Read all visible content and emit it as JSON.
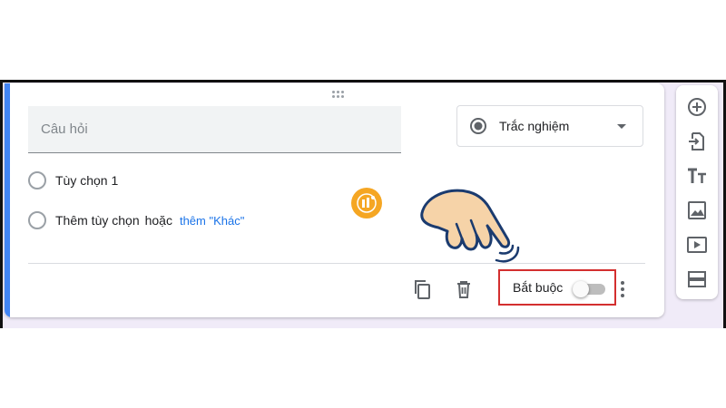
{
  "question": {
    "placeholder": "Câu hỏi"
  },
  "question_type": {
    "label": "Trắc nghiệm",
    "icon": "radio-button-icon"
  },
  "options": [
    {
      "label": "Tùy chọn 1"
    }
  ],
  "add_option": {
    "add_label": "Thêm tùy chọn",
    "or_label": "hoặc",
    "other_link": "thêm \"Khác\""
  },
  "footer": {
    "required_label": "Bắt buộc",
    "required_on": false,
    "duplicate_icon": "copy-icon",
    "delete_icon": "trash-icon",
    "more_icon": "more-vert-icon"
  },
  "sidebar": {
    "items": [
      "add-question-icon",
      "import-questions-icon",
      "add-title-icon",
      "add-image-icon",
      "add-video-icon",
      "add-section-icon"
    ]
  },
  "colors": {
    "accent": "#4285f4",
    "highlight_box": "#d32f2f",
    "background": "#f0ebf8"
  }
}
